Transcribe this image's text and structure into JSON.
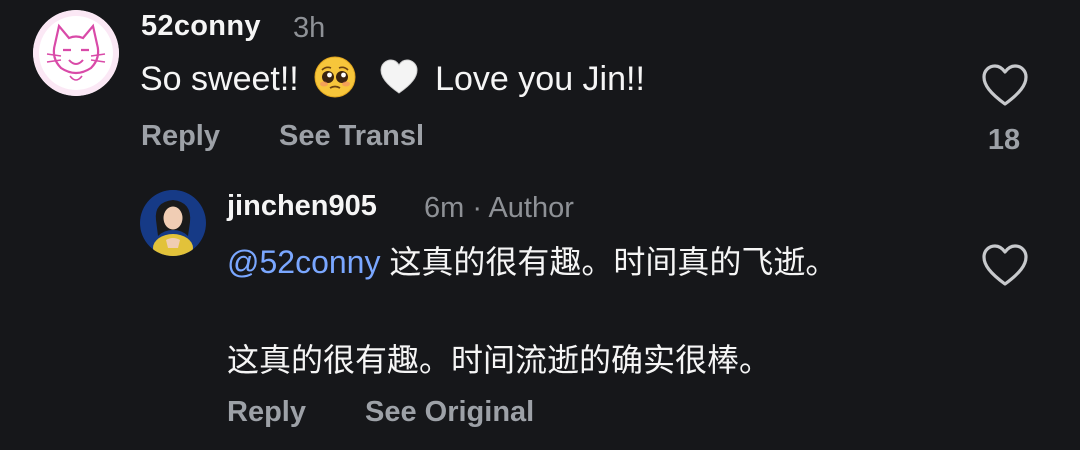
{
  "comments": [
    {
      "username": "52conny",
      "time": "3h",
      "text_before_emoji": "So sweet!!",
      "text_after_emoji": "Love you Jin!!",
      "emojis": [
        "pleading-face-emoji",
        "white-heart-emoji"
      ],
      "reply_label": "Reply",
      "translate_label": "See Transl",
      "likes": "18",
      "avatar_icon": "cat-doodle-avatar"
    },
    {
      "username": "jinchen905",
      "time_author": "6m · Author",
      "mention": "@52conny",
      "text": " 这真的很有趣。时间真的飞逝。",
      "translated_text": "这真的很有趣。时间流逝的确实很棒。",
      "reply_label": "Reply",
      "original_label": "See Original",
      "avatar_icon": "profile-photo-avatar"
    }
  ],
  "colors": {
    "background": "#16171a",
    "primary_text": "#f5f5f5",
    "secondary_text": "#9da1a7",
    "mention": "#7aa7ff"
  }
}
